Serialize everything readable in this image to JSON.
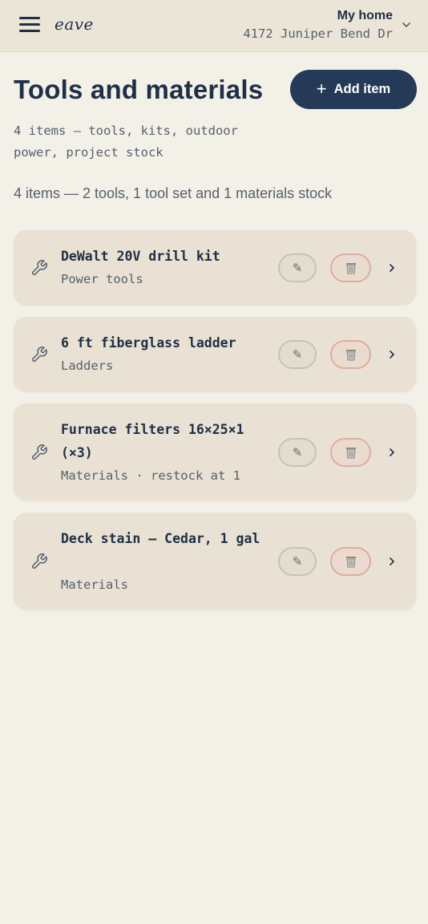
{
  "header": {
    "logo": "eave",
    "home_name": "My home",
    "home_address": "4172 Juniper Bend Dr"
  },
  "page": {
    "title": "Tools and materials",
    "add_label": "Add item",
    "subtitle": "4 items — tools, kits, outdoor power, project stock",
    "summary": "4 items — 2 tools, 1 tool set and 1 materials stock"
  },
  "items": [
    {
      "name": "DeWalt 20V drill kit",
      "meta": "Power tools"
    },
    {
      "name": "6 ft fiberglass ladder",
      "meta": "Ladders"
    },
    {
      "name": "Furnace filters 16×25×1 (×3)",
      "meta": "Materials · restock at 1"
    },
    {
      "name": "Deck stain — Cedar, 1 gal",
      "meta": "Materials"
    }
  ],
  "colors": {
    "background": "#f3f0e8",
    "topbar": "#ebe5d8",
    "card": "#e8e1d4",
    "primary": "#243a56",
    "delete_border": "#dcae9e"
  },
  "icons": {
    "menu": "hamburger-icon",
    "home_dropdown": "chevron-down-icon",
    "item": "wrench-icon",
    "edit": "pencil-icon",
    "delete": "trash-icon",
    "open": "chevron-right-icon",
    "add": "plus-icon"
  }
}
